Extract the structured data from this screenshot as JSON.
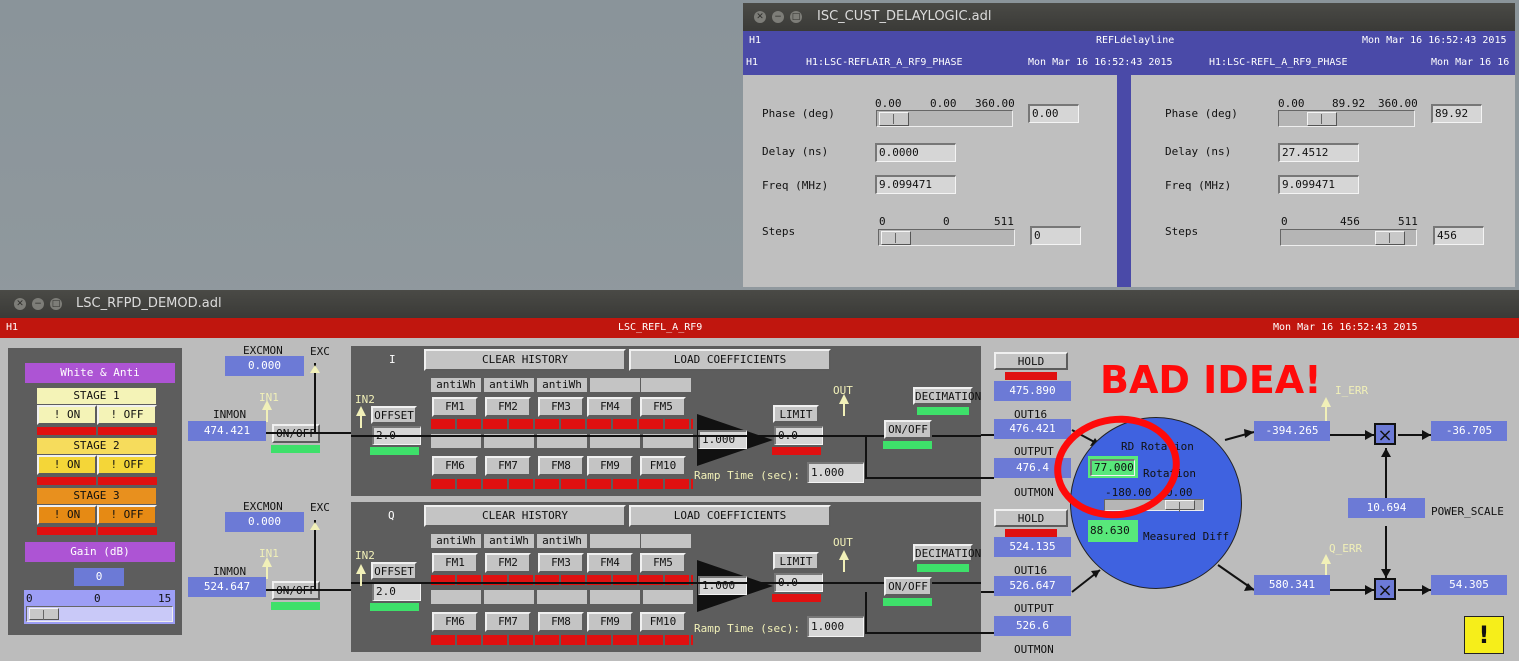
{
  "delaylogic": {
    "title": "ISC_CUST_DELAYLOGIC.adl",
    "site": "H1",
    "name": "REFLdelayline",
    "timestamp": "Mon Mar 16 16:52:43 2015",
    "left": {
      "site": "H1",
      "channel": "H1:LSC-REFLAIR_A_RF9_PHASE",
      "timestamp": "Mon Mar 16 16:52:43 2015",
      "phase_label": "Phase (deg)",
      "phase_min": "0.00",
      "phase_val": "0.00",
      "phase_max": "360.00",
      "phase_entry": "0.00",
      "phase_frac": 0.0,
      "delay_label": "Delay (ns)",
      "delay": "0.0000",
      "freq_label": "Freq (MHz)",
      "freq": "9.099471",
      "steps_label": "Steps",
      "steps_min": "0",
      "steps_val": "0",
      "steps_max": "511",
      "steps_entry": "0",
      "steps_frac": 0.0
    },
    "right": {
      "channel": "H1:LSC-REFL_A_RF9_PHASE",
      "timestamp": "Mon Mar 16 16",
      "phase_label": "Phase (deg)",
      "phase_min": "0.00",
      "phase_val": "89.92",
      "phase_max": "360.00",
      "phase_entry": "89.92",
      "phase_frac": 0.25,
      "delay_label": "Delay (ns)",
      "delay": "27.4512",
      "freq_label": "Freq (MHz)",
      "freq": "9.099471",
      "steps_label": "Steps",
      "steps_min": "0",
      "steps_val": "456",
      "steps_max": "511",
      "steps_entry": "456",
      "steps_frac": 0.89
    }
  },
  "demod": {
    "title": "LSC_RFPD_DEMOD.adl",
    "site": "H1",
    "name": "LSC_REFL_A_RF9",
    "timestamp": "Mon Mar 16 16:52:43 2015",
    "whitening": {
      "header": "White &  Anti",
      "stages": [
        {
          "label": "STAGE 1",
          "on": "! ON",
          "off": "! OFF"
        },
        {
          "label": "STAGE 2",
          "on": "! ON",
          "off": "! OFF"
        },
        {
          "label": "STAGE 3",
          "on": "! ON",
          "off": "! OFF"
        }
      ],
      "gain_label": "Gain (dB)",
      "gain_value": "0",
      "slider_min": "0",
      "slider_val": "0",
      "slider_max": "15",
      "slider_frac": 0.0
    },
    "chan_i": {
      "excmon_label": "EXCMON",
      "excmon": "0.000",
      "exc_label": "EXC",
      "inmon_label": "INMON",
      "inmon": "474.421",
      "in1_label": "IN1",
      "onoff": "ON/OFF",
      "in2_label": "IN2",
      "name": "I",
      "clear_history": "CLEAR HISTORY",
      "load_coefficients": "LOAD COEFFICIENTS",
      "offset_label": "OFFSET",
      "offset": "2.0",
      "filters_top": [
        {
          "tag": "antiWh",
          "fm": "FM1"
        },
        {
          "tag": "antiWh",
          "fm": "FM2"
        },
        {
          "tag": "antiWh",
          "fm": "FM3"
        },
        {
          "tag": "",
          "fm": "FM4"
        },
        {
          "tag": "",
          "fm": "FM5"
        }
      ],
      "filters_bottom": [
        "FM6",
        "FM7",
        "FM8",
        "FM9",
        "FM10"
      ],
      "gain": "1.000",
      "limit_label": "LIMIT",
      "limit": "0.0",
      "ramp_label": "Ramp Time (sec):",
      "ramp": "1.000",
      "out_label": "OUT",
      "onoff2": "ON/OFF",
      "decimation": "DECIMATION",
      "hold_output": "HOLD OUTPUT",
      "decim_value": "475.890",
      "out16_label": "OUT16",
      "out16": "476.421",
      "output_label": "OUTPUT",
      "output": "476.4",
      "outmon_label": "OUTMON"
    },
    "chan_q": {
      "excmon_label": "EXCMON",
      "excmon": "0.000",
      "exc_label": "EXC",
      "inmon_label": "INMON",
      "inmon": "524.647",
      "in1_label": "IN1",
      "onoff": "ON/OFF",
      "in2_label": "IN2",
      "name": "Q",
      "clear_history": "CLEAR HISTORY",
      "load_coefficients": "LOAD COEFFICIENTS",
      "offset_label": "OFFSET",
      "offset": "2.0",
      "filters_top": [
        {
          "tag": "antiWh",
          "fm": "FM1"
        },
        {
          "tag": "antiWh",
          "fm": "FM2"
        },
        {
          "tag": "antiWh",
          "fm": "FM3"
        },
        {
          "tag": "",
          "fm": "FM4"
        },
        {
          "tag": "",
          "fm": "FM5"
        }
      ],
      "filters_bottom": [
        "FM6",
        "FM7",
        "FM8",
        "FM9",
        "FM10"
      ],
      "gain": "1.000",
      "limit_label": "LIMIT",
      "limit": "0.0",
      "ramp_label": "Ramp Time (sec):",
      "ramp": "1.000",
      "out_label": "OUT",
      "onoff2": "ON/OFF",
      "decimation": "DECIMATION",
      "hold_output": "HOLD OUTPUT",
      "decim_value": "524.135",
      "out16_label": "OUT16",
      "out16": "526.647",
      "output_label": "OUTPUT",
      "output": "526.6",
      "outmon_label": "OUTMON"
    },
    "rotation": {
      "rd_label": "RD Rotation",
      "rotation_entry": "77.000",
      "rotation_label": "Rotation",
      "slider_left": "-180.00",
      "slider_right": "0.00",
      "measured": "88.630",
      "measured_label": "Measured Diff"
    },
    "annotation": "BAD IDEA!",
    "i_err_label": "I_ERR",
    "i_err": "-394.265",
    "i_out": "-36.705",
    "q_err_label": "Q_ERR",
    "q_err": "580.341",
    "q_out": "54.305",
    "power_scale": "10.694",
    "power_scale_label": "POWER_SCALE",
    "mult_symbol": "×",
    "alert_symbol": "!"
  },
  "colors": {
    "delay_bar": "#4a4aa8",
    "demod_bar": "#c0160e",
    "readback": "#6c7ad6",
    "alarm_red": "#e01010",
    "status_green": "#3ee06a",
    "circle": "#3f62e0",
    "annotation_red": "#ff0a0a"
  }
}
